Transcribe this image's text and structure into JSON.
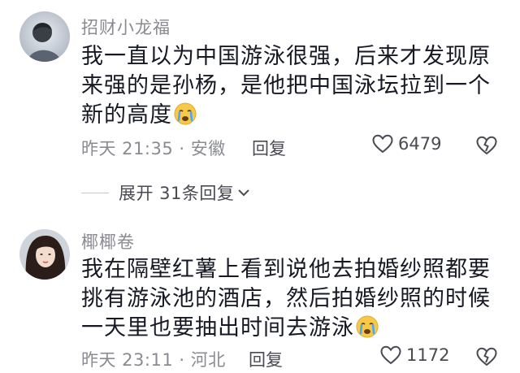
{
  "comments": [
    {
      "username": "招财小龙福",
      "lines": [
        "我一直以为中国游泳很强，后来才发现原",
        "来强的是孙杨，是他把中国泳坛拉到一个",
        "新的高度"
      ],
      "meta": "昨天 21:35 · 安徽",
      "reply_label": "回复",
      "likes": "6479",
      "emoji": "crying-face-icon"
    },
    {
      "username": "椰椰卷",
      "lines": [
        "我在隔壁红薯上看到说他去拍婚纱照都要",
        "挑有游泳池的酒店，然后拍婚纱照的时候",
        "一天里也要抽出时间去游泳"
      ],
      "meta": "昨天 23:11 · 河北",
      "reply_label": "回复",
      "likes": "1172",
      "emoji": "crying-face-icon"
    }
  ],
  "expand": {
    "label": "展开 31条回复"
  },
  "colors": {
    "text": "#161823",
    "secondary": "#8a8b91",
    "action": "#4a4b52"
  }
}
